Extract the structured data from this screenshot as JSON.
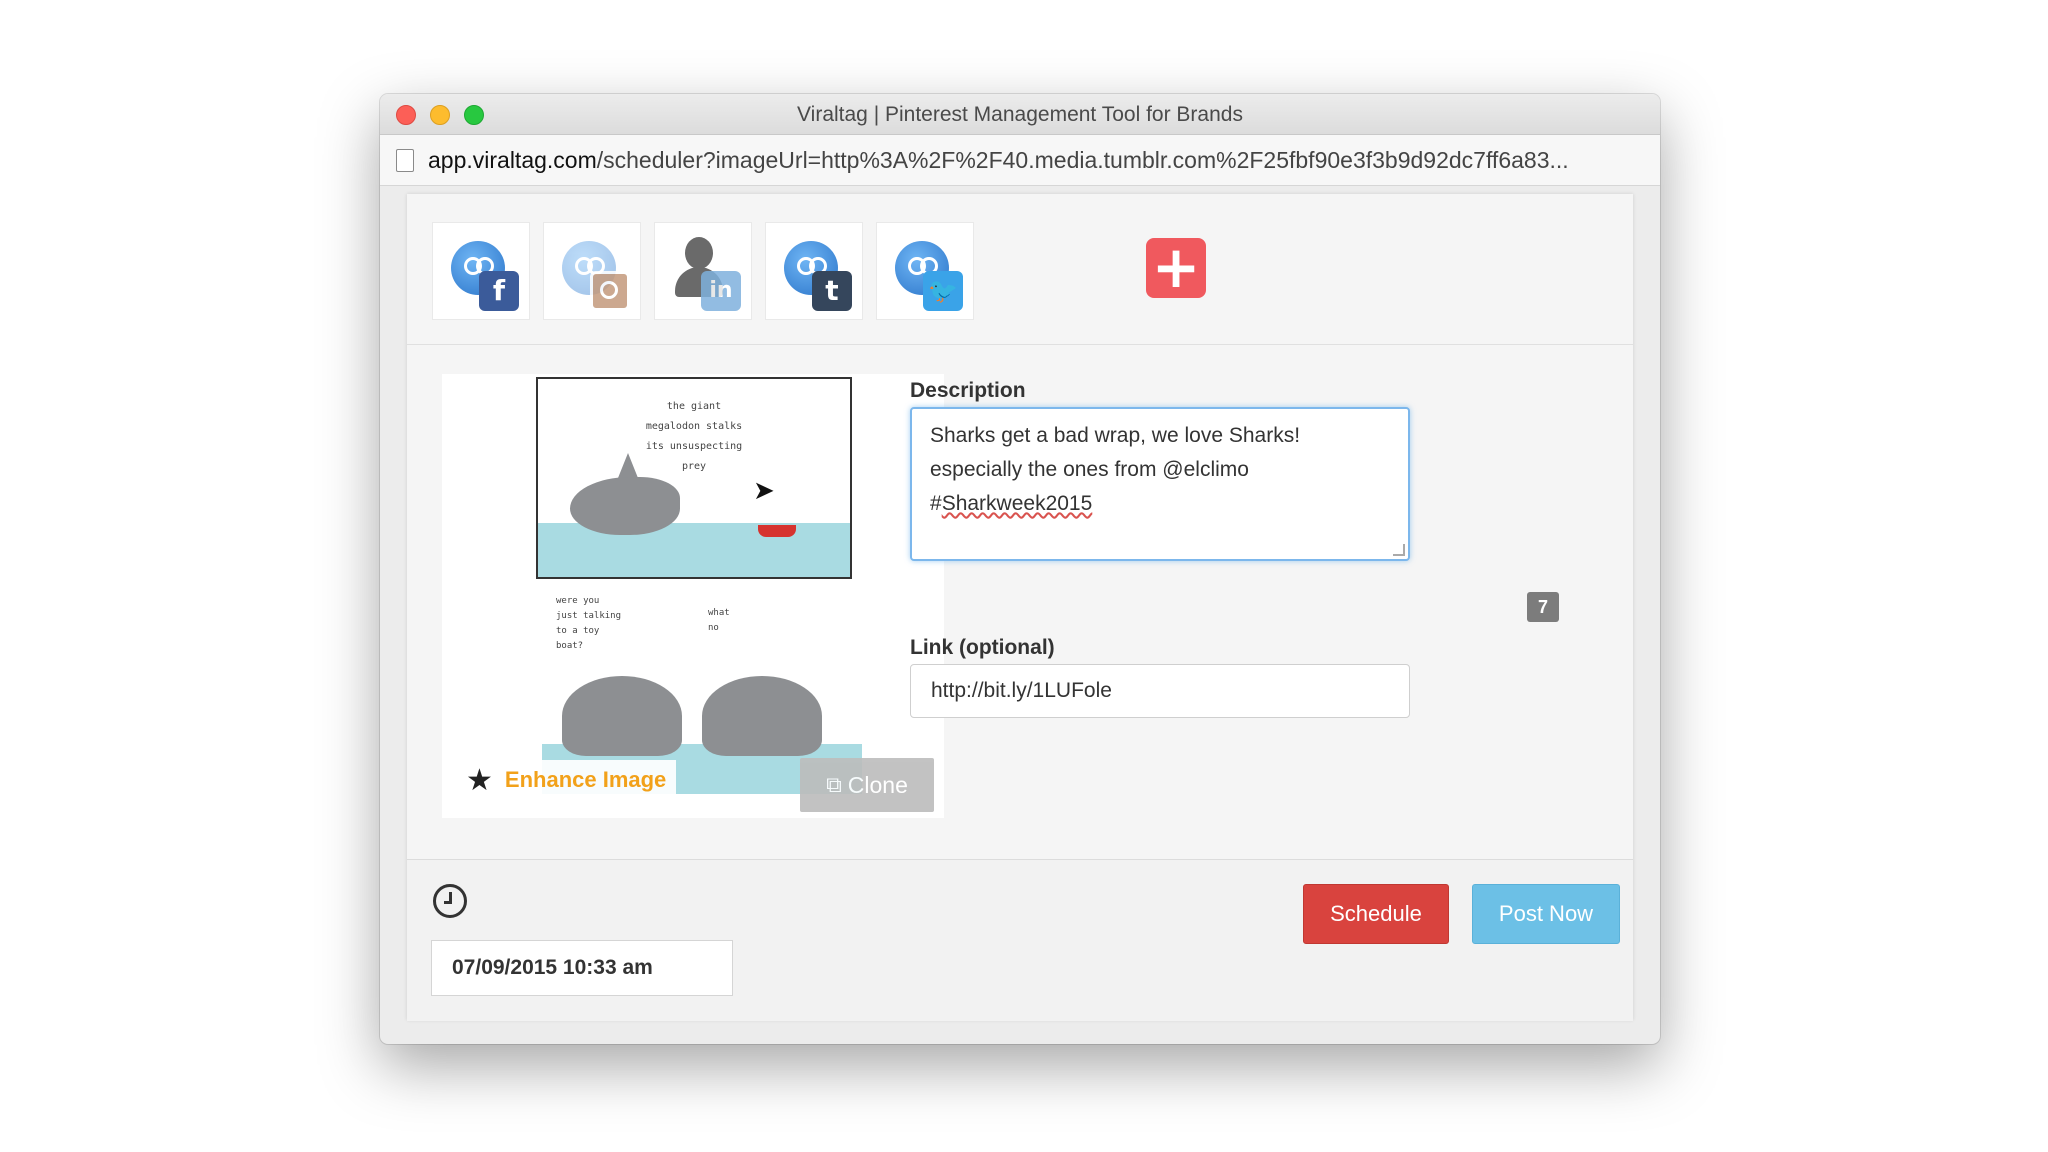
{
  "window": {
    "title": "Viraltag | Pinterest Management Tool for Brands",
    "url_domain": "app.viraltag.com",
    "url_path": "/scheduler?imageUrl=http%3A%2F%2F40.media.tumblr.com%2F25fbf90e3f3b9d92dc7ff6a83..."
  },
  "accounts": [
    {
      "network": "facebook",
      "icon": "viraltag-avatar-icon",
      "badge": "f"
    },
    {
      "network": "instagram",
      "icon": "viraltag-avatar-icon",
      "badge": ""
    },
    {
      "network": "linkedin",
      "icon": "person-silhouette-icon",
      "badge": "in"
    },
    {
      "network": "tumblr",
      "icon": "viraltag-avatar-icon",
      "badge": "t"
    },
    {
      "network": "twitter",
      "icon": "viraltag-avatar-icon",
      "badge": "🐦"
    }
  ],
  "add_account": "+",
  "image_panel": {
    "comic_top_caption": "the giant\nmegalodon stalks\nits unsuspecting\nprey",
    "comic_bottom_left": "were you\njust talking\nto a toy\nboat?",
    "comic_bottom_right": "what\nno",
    "enhance_label": "Enhance Image",
    "clone_label": "Clone"
  },
  "form": {
    "description_label": "Description",
    "description_line1": "Sharks get a bad wrap, we love Sharks!",
    "description_line2": "especially the ones from @elclimo",
    "description_hash": "#",
    "description_tag": "Sharkweek2015",
    "char_count": "7",
    "link_label": "Link (optional)",
    "link_value": "http://bit.ly/1LUFole"
  },
  "footer": {
    "datetime": "07/09/2015 10:33 am",
    "schedule_label": "Schedule",
    "post_now_label": "Post Now"
  },
  "colors": {
    "schedule": "#d9433e",
    "post_now": "#6cc0e6",
    "enhance": "#f2a11a",
    "add_account": "#f0595e"
  }
}
